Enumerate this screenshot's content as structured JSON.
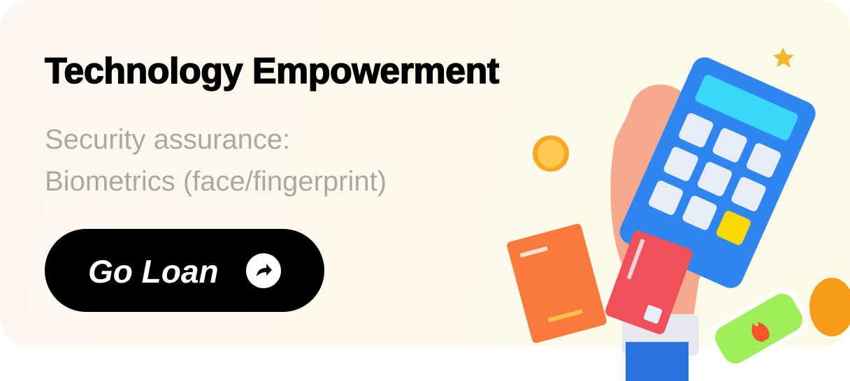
{
  "banner": {
    "title": "Technology Empowerment",
    "subtitle_line1": "Security assurance:",
    "subtitle_line2": "Biometrics (face/fingerprint)",
    "button_label": "Go Loan",
    "button_icon": "share-arrow-icon"
  },
  "colors": {
    "button_bg": "#000000",
    "subtitle": "#aaa8a5",
    "calculator": "#2f86f0",
    "card": "#f0505a",
    "receipt": "#f97a3c"
  }
}
